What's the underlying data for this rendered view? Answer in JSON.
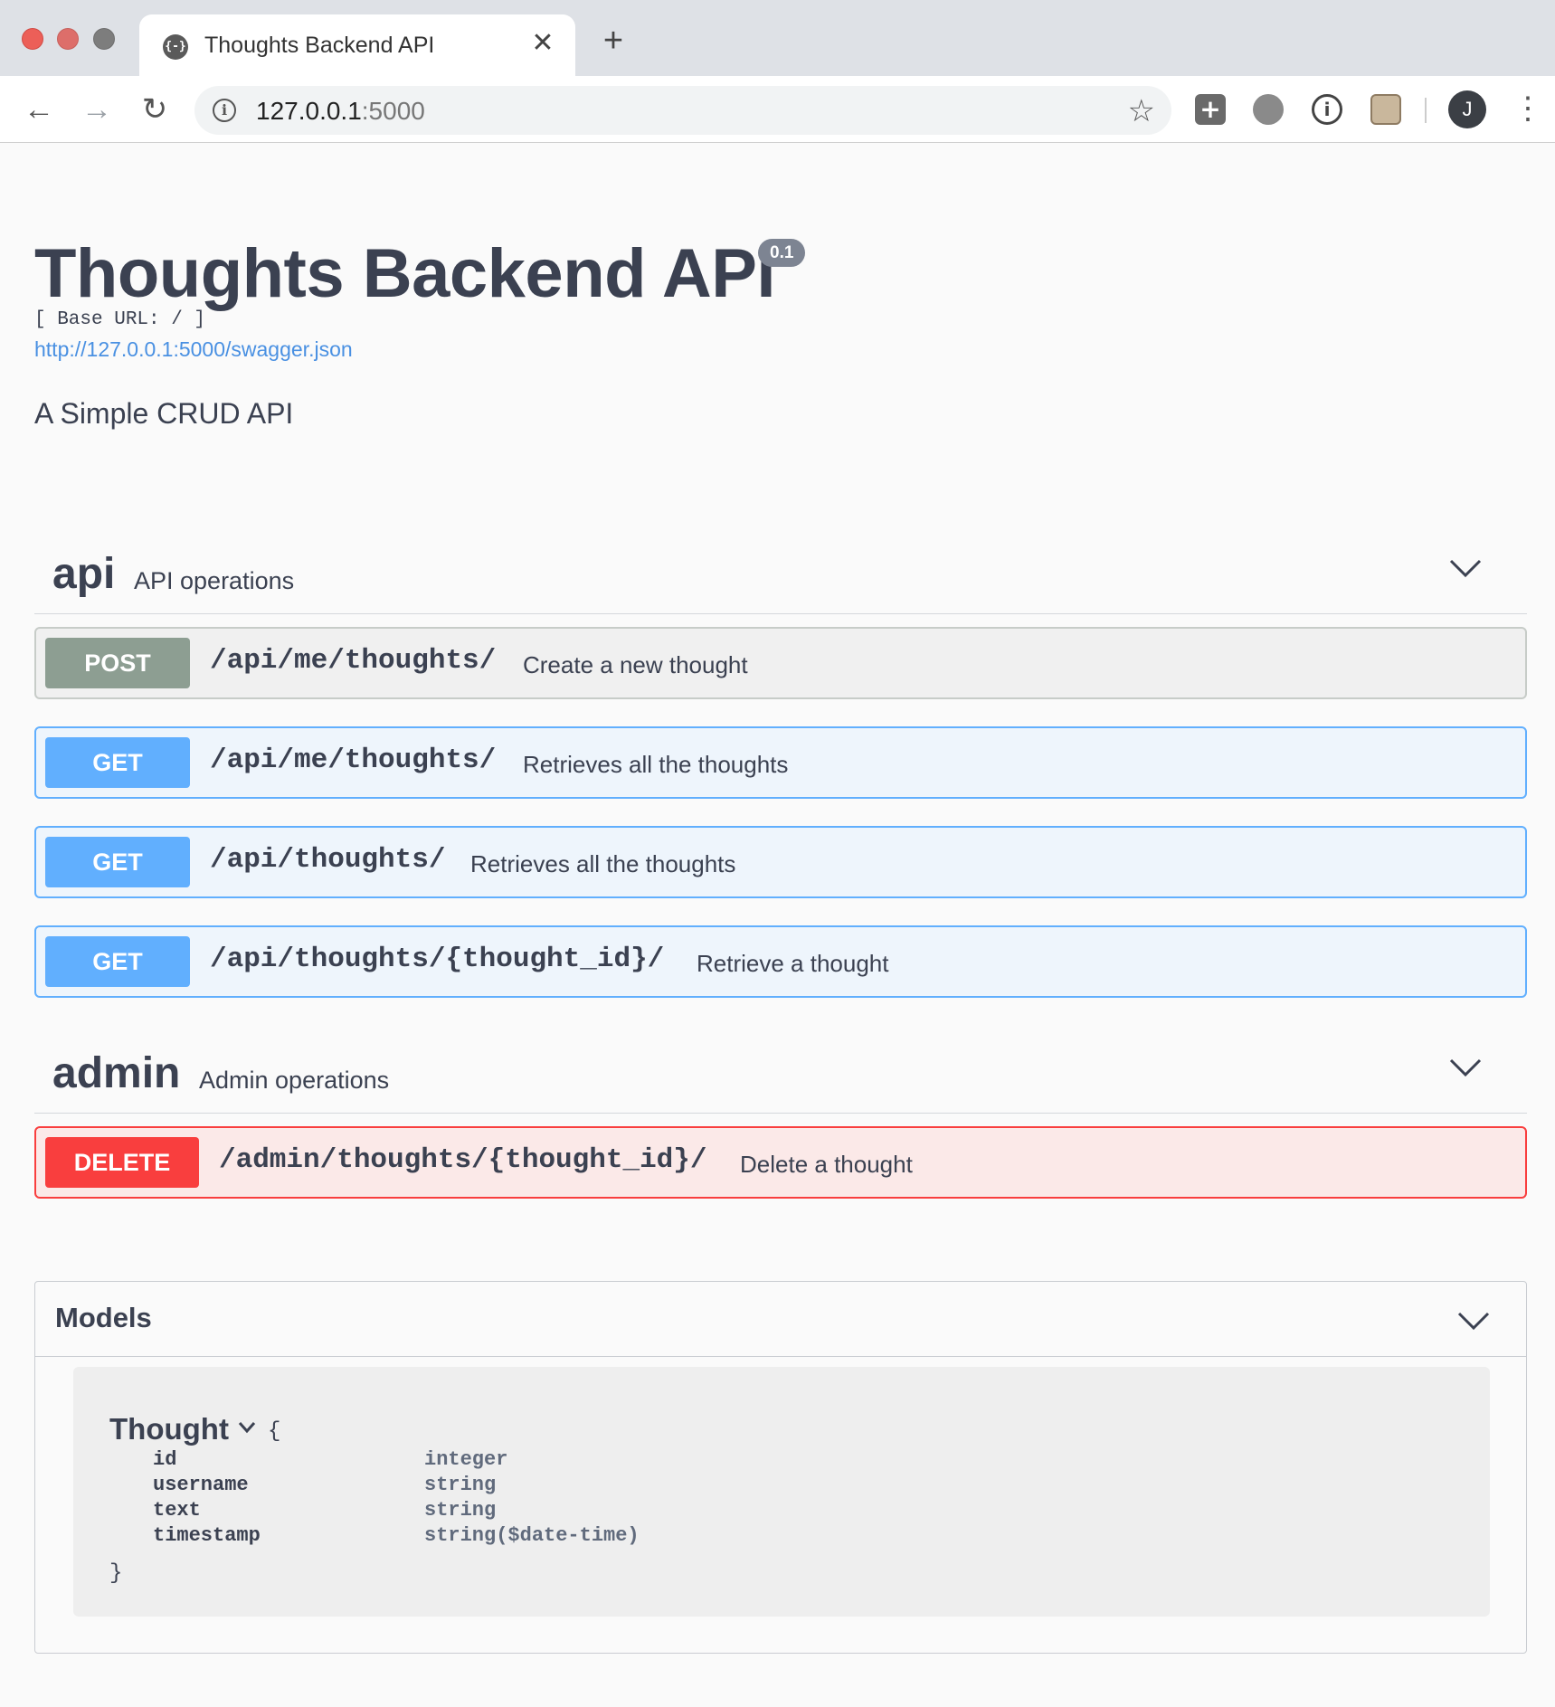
{
  "browser": {
    "tab_title": "Thoughts Backend API",
    "tab_favicon_text": "{-}",
    "url_host": "127.0.0.1",
    "url_port": ":5000",
    "profile_initial": "J"
  },
  "info": {
    "title": "Thoughts Backend API",
    "version": "0.1",
    "base_url": "[ Base URL: / ]",
    "spec_url": "http://127.0.0.1:5000/swagger.json",
    "description": "A Simple CRUD API"
  },
  "tags": [
    {
      "name": "api",
      "description": "API operations",
      "operations": [
        {
          "method": "POST",
          "path": "/api/me/thoughts/",
          "summary": "Create a new thought"
        },
        {
          "method": "GET",
          "path": "/api/me/thoughts/",
          "summary": "Retrieves all the thoughts"
        },
        {
          "method": "GET",
          "path": "/api/thoughts/",
          "summary": "Retrieves all the thoughts"
        },
        {
          "method": "GET",
          "path": "/api/thoughts/{thought_id}/",
          "summary": "Retrieve a thought"
        }
      ]
    },
    {
      "name": "admin",
      "description": "Admin operations",
      "operations": [
        {
          "method": "DELETE",
          "path": "/admin/thoughts/{thought_id}/",
          "summary": "Delete a thought"
        }
      ]
    }
  ],
  "models": {
    "title": "Models",
    "items": [
      {
        "name": "Thought",
        "open_brace": "{",
        "close_brace": "}",
        "properties": [
          {
            "name": "id",
            "type": "integer"
          },
          {
            "name": "username",
            "type": "string"
          },
          {
            "name": "text",
            "type": "string"
          },
          {
            "name": "timestamp",
            "type": "string($date-time)"
          }
        ]
      }
    ]
  },
  "colors": {
    "post": "#8d9e92",
    "get": "#61affe",
    "delete": "#f93e3e",
    "text": "#3b4151",
    "link": "#4990e2"
  },
  "icons": [
    "back-arrow-icon",
    "forward-arrow-icon",
    "reload-icon",
    "info-icon",
    "star-icon",
    "chevron-down-icon",
    "close-icon",
    "plus-icon",
    "menu-icon"
  ]
}
